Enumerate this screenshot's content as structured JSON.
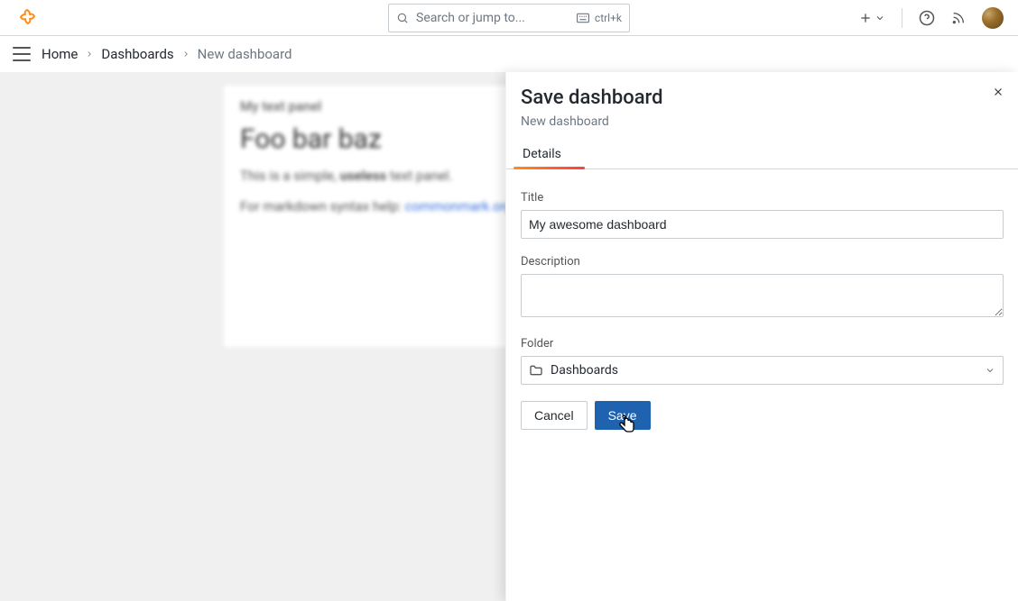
{
  "search": {
    "placeholder": "Search or jump to...",
    "shortcut": "ctrl+k"
  },
  "breadcrumbs": {
    "home": "Home",
    "dashboards": "Dashboards",
    "current": "New dashboard"
  },
  "panel": {
    "title": "My text panel",
    "heading": "Foo bar baz",
    "text_before": "This is a simple, ",
    "text_bold": "useless",
    "text_after": " text panel.",
    "help_prefix": "For markdown syntax help: ",
    "help_link": "commonmark.org"
  },
  "drawer": {
    "title": "Save dashboard",
    "subtitle": "New dashboard",
    "tab_details": "Details",
    "label_title": "Title",
    "value_title": "My awesome dashboard",
    "label_description": "Description",
    "value_description": "",
    "label_folder": "Folder",
    "value_folder": "Dashboards",
    "btn_cancel": "Cancel",
    "btn_save": "Save"
  }
}
